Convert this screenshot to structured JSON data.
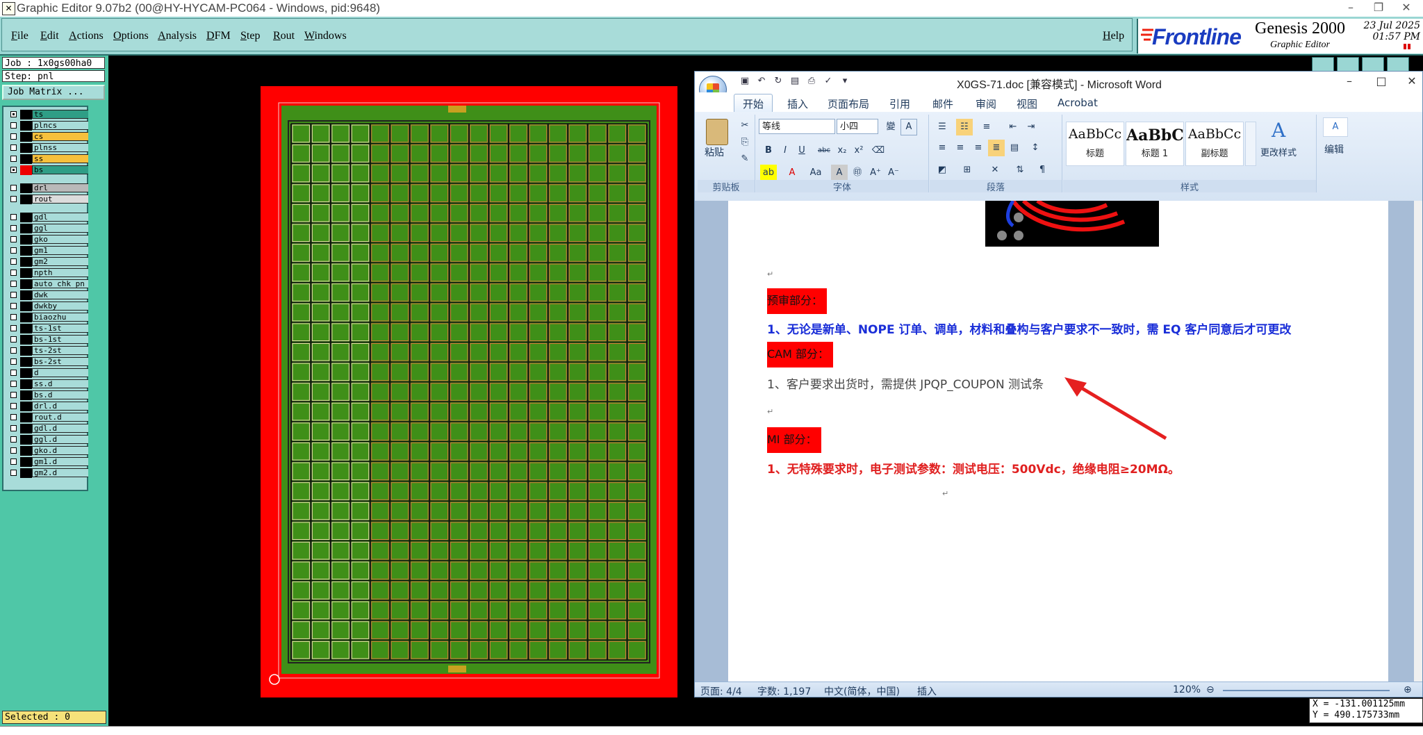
{
  "genesis": {
    "title": "Graphic Editor 9.07b2 (00@HY-HYCAM-PC064 - Windows, pid:9648)",
    "menu": [
      "File",
      "Edit",
      "Actions",
      "Options",
      "Analysis",
      "DFM",
      "Step",
      "Rout",
      "Windows"
    ],
    "help": "Help",
    "brand": {
      "logo": "Frontline",
      "product": "Genesis 2000",
      "subtitle": "Graphic Editor",
      "date": "23 Jul 2025",
      "time": "01:57 PM"
    },
    "job": "Job : 1x0gs00ha0",
    "step": "Step: pnl",
    "job_matrix": "Job Matrix ...",
    "layers": [
      {
        "name": "ts",
        "color": "#2f9e86",
        "on": true
      },
      {
        "name": "plncs",
        "color": "#000000",
        "on": false
      },
      {
        "name": "cs",
        "color": "#f6c03c",
        "on": false
      },
      {
        "name": "plnss",
        "color": "#000000",
        "on": false
      },
      {
        "name": "ss",
        "color": "#f6c03c",
        "on": false
      },
      {
        "name": "bs",
        "color": "#2f9e86",
        "on": true
      },
      {
        "name": "drl",
        "color": "#b9b9b9",
        "on": false
      },
      {
        "name": "rout",
        "color": "#dcdcdc",
        "on": false
      },
      {
        "name": "gdl",
        "color": "#000000",
        "on": false
      },
      {
        "name": "ggl",
        "color": "#000000",
        "on": false
      },
      {
        "name": "gko",
        "color": "#000000",
        "on": false
      },
      {
        "name": "gm1",
        "color": "#000000",
        "on": false
      },
      {
        "name": "gm2",
        "color": "#000000",
        "on": false
      },
      {
        "name": "npth",
        "color": "#000000",
        "on": false
      },
      {
        "name": "auto_chk_pn",
        "color": "#000000",
        "on": false
      },
      {
        "name": "dwk",
        "color": "#000000",
        "on": false
      },
      {
        "name": "dwkby",
        "color": "#000000",
        "on": false
      },
      {
        "name": "biaozhu",
        "color": "#000000",
        "on": false
      },
      {
        "name": "ts-1st",
        "color": "#000000",
        "on": false
      },
      {
        "name": "bs-1st",
        "color": "#000000",
        "on": false
      },
      {
        "name": "ts-2st",
        "color": "#000000",
        "on": false
      },
      {
        "name": "bs-2st",
        "color": "#000000",
        "on": false
      },
      {
        "name": "d",
        "color": "#000000",
        "on": false
      },
      {
        "name": "ss.d",
        "color": "#000000",
        "on": false
      },
      {
        "name": "bs.d",
        "color": "#000000",
        "on": false
      },
      {
        "name": "drl.d",
        "color": "#000000",
        "on": false
      },
      {
        "name": "rout.d",
        "color": "#000000",
        "on": false
      },
      {
        "name": "gdl.d",
        "color": "#000000",
        "on": false
      },
      {
        "name": "ggl.d",
        "color": "#000000",
        "on": false
      },
      {
        "name": "gko.d",
        "color": "#000000",
        "on": false
      },
      {
        "name": "gm1.d",
        "color": "#000000",
        "on": false
      },
      {
        "name": "gm2.d",
        "color": "#000000",
        "on": false
      }
    ],
    "selected": "Selected : 0",
    "coords": {
      "x": "X = -131.001125mm",
      "y": "Y = 490.175733mm"
    },
    "board": {
      "columns": 18,
      "rows": 27,
      "fill": "#3f8f18",
      "frame": "#ff0000"
    }
  },
  "word": {
    "title": "X0GS-71.doc [兼容模式] - Microsoft Word",
    "tabs": [
      "开始",
      "插入",
      "页面布局",
      "引用",
      "邮件",
      "审阅",
      "视图",
      "Acrobat"
    ],
    "clipboard": {
      "paste": "粘贴",
      "group": "剪贴板"
    },
    "font": {
      "name": "等线",
      "size": "小四",
      "group": "字体"
    },
    "paragraph": {
      "group": "段落"
    },
    "styles": {
      "items": [
        {
          "preview": "AaBbCc",
          "name": "标题"
        },
        {
          "preview": "AaBbC",
          "name": "标题 1"
        },
        {
          "preview": "AaBbCc",
          "name": "副标题"
        }
      ],
      "change": "更改样式",
      "group": "样式"
    },
    "editing": "编辑",
    "doc": {
      "pretrial_head": "预审部分：",
      "pretrial_1": "1、无论是新单、NOPE 订单、调单，材料和叠构与客户要求不一致时，需 EQ 客户同意后才可更改",
      "cam_head": "CAM 部分：",
      "cam_1": "1、客户要求出货时，需提供 JPQP_COUPON 测试条",
      "mi_head": "MI 部分：",
      "mi_1": "1、无特殊要求时，电子测试参数：测试电压：500Vdc，绝缘电阻≥20MΩ。"
    },
    "status": {
      "page": "页面: 4/4",
      "words": "字数: 1,197",
      "lang": "中文(简体，中国)",
      "mode": "插入",
      "zoom": "120%"
    }
  }
}
